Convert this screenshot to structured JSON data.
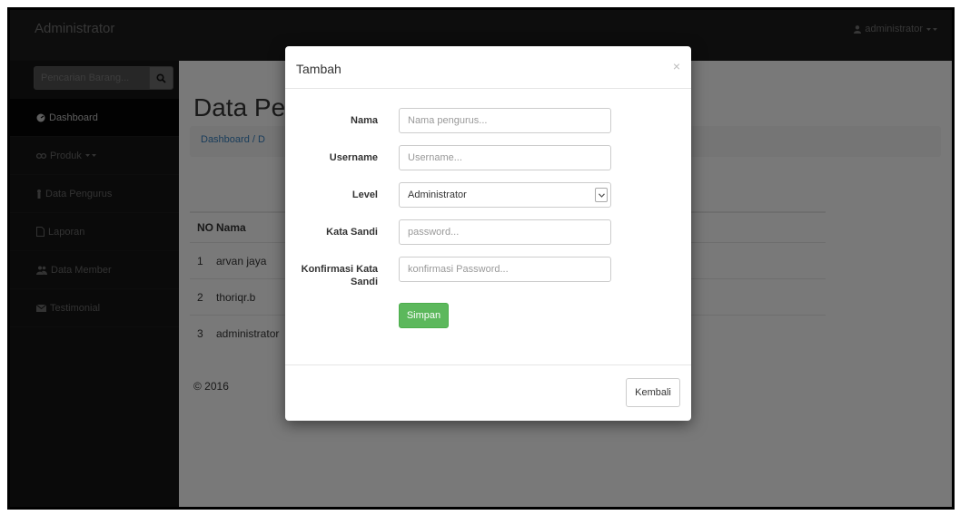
{
  "navbar": {
    "brand": "Administrator",
    "user": "administrator"
  },
  "sidebar": {
    "search_placeholder": "Pencarian Barang...",
    "items": [
      {
        "label": "Dashboard",
        "icon": "dashboard-icon",
        "active": true
      },
      {
        "label": "Produk",
        "icon": "produk-icon"
      },
      {
        "label": "Data Pengurus",
        "icon": "user-icon"
      },
      {
        "label": "Laporan",
        "icon": "file-icon"
      },
      {
        "label": "Data Member",
        "icon": "users-icon"
      },
      {
        "label": "Testimonial",
        "icon": "envelope-icon"
      }
    ]
  },
  "main": {
    "title": "Data Pe",
    "breadcrumb": "Dashboard / D",
    "table": {
      "headers": [
        "NO",
        "Nama"
      ],
      "rows": [
        [
          "1",
          "arvan jaya"
        ],
        [
          "2",
          "thoriqr.b"
        ],
        [
          "3",
          "administrator"
        ]
      ]
    },
    "copyright": "© 2016"
  },
  "modal": {
    "title": "Tambah",
    "close": "×",
    "fields": {
      "nama": {
        "label": "Nama",
        "placeholder": "Nama pengurus..."
      },
      "username": {
        "label": "Username",
        "placeholder": "Username..."
      },
      "level": {
        "label": "Level",
        "value": "Administrator"
      },
      "password": {
        "label": "Kata Sandi",
        "placeholder": "password..."
      },
      "confirm": {
        "label": "Konfirmasi Kata Sandi",
        "placeholder": "konfirmasi Password..."
      }
    },
    "save_label": "Simpan",
    "back_label": "Kembali"
  }
}
